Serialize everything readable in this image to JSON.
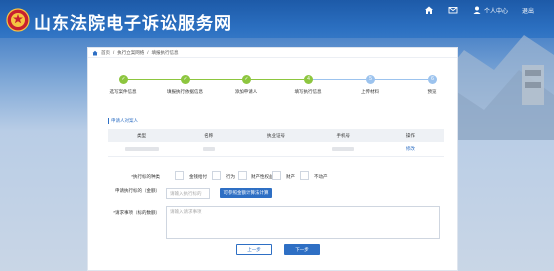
{
  "header": {
    "site_title": "山东法院电子诉讼服务网",
    "nav": {
      "home_icon": "home-icon",
      "mail_icon": "mail-icon",
      "user_icon": "user-icon",
      "user_center_label": "个人中心",
      "logout_label": "退出"
    }
  },
  "breadcrumb": {
    "items": [
      "首页",
      "执行立案网络",
      "填报执行信息"
    ]
  },
  "steps": [
    {
      "label": "选写案件信息",
      "state": "done",
      "mark": "✓"
    },
    {
      "label": "填报执行依据信息",
      "state": "done",
      "mark": "✓"
    },
    {
      "label": "添加申请人",
      "state": "done",
      "mark": "✓"
    },
    {
      "label": "填写执行信息",
      "state": "current",
      "mark": "4"
    },
    {
      "label": "上传材料",
      "state": "todo",
      "mark": "5"
    },
    {
      "label": "预览",
      "state": "todo",
      "mark": "6"
    }
  ],
  "section": {
    "title": "申请人对案人"
  },
  "table": {
    "headers": [
      "类型",
      "名称",
      "执业证号",
      "手机号",
      "操作"
    ],
    "rows": [
      {
        "op": "修改"
      }
    ]
  },
  "form": {
    "mode_label": "*执行标的种类",
    "options": [
      "金钱给付",
      "行为",
      "财产性权益",
      "财产",
      "不动产"
    ],
    "amount_label": "申请执行标的（金额）",
    "amount_placeholder": "请输入执行标的",
    "calc_button": "可参照金额计算法计算",
    "request_label": "*请求事项（标的数额）",
    "request_placeholder": "请输入请求事项"
  },
  "footer": {
    "prev_button": "上一步",
    "next_button": "下一步"
  },
  "colors": {
    "accent": "#2e6fc4",
    "done": "#8dc63f",
    "todo": "#9cc3ee"
  }
}
